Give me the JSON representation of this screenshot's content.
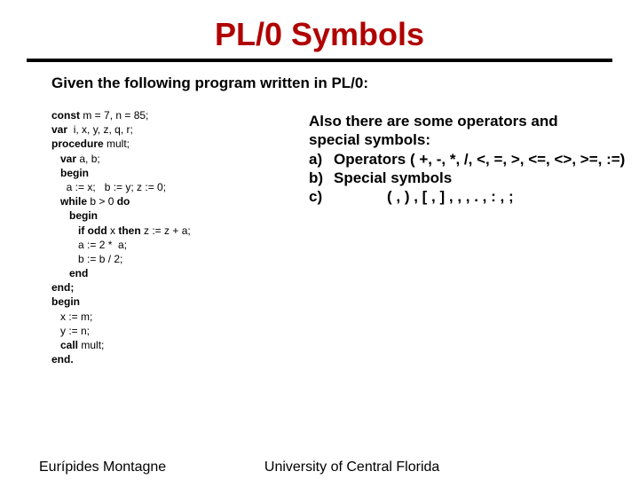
{
  "title": "PL/0 Symbols",
  "intro": "Given the following program written in PL/0:",
  "code": {
    "l1a": "const ",
    "l1b": "m = 7, n = 85;",
    "l2a": "var ",
    "l2b": " i, x, y, z, q, r;",
    "l3a": "procedure ",
    "l3b": "mult;",
    "l4a": "   var ",
    "l4b": "a, b;",
    "l5a": "   begin",
    "l6": "     a := x;   b := y; z := 0;",
    "l7a": "   while ",
    "l7b": "b > 0 ",
    "l7c": "do",
    "l8a": "      begin",
    "l9a": "         if ",
    "l9b": "odd ",
    "l9c": "x ",
    "l9d": "then ",
    "l9e": "z := z + a;",
    "l10": "         a := 2 *  a;",
    "l11": "         b := b / 2;",
    "l12": "      end",
    "l13": "end;",
    "l14": "begin",
    "l15": "   x := m;",
    "l16": "   y := n;",
    "l17": "   call ",
    "l17b": "mult;",
    "l18": "end."
  },
  "notes": {
    "heading1": "Also there are some operators and",
    "heading2": "special symbols:",
    "a_label": "a)",
    "a_text": "Operators ( +, -, *, /, <, =, >, <=, <>, >=, :=)",
    "b_label": "b)",
    "b_text": "Special symbols",
    "c_label": "c)",
    "c_text": "( ,  ) , [ , ] , , , . , : , ;"
  },
  "footer": {
    "author": "Eurípides Montagne",
    "org": "University of Central Florida"
  }
}
